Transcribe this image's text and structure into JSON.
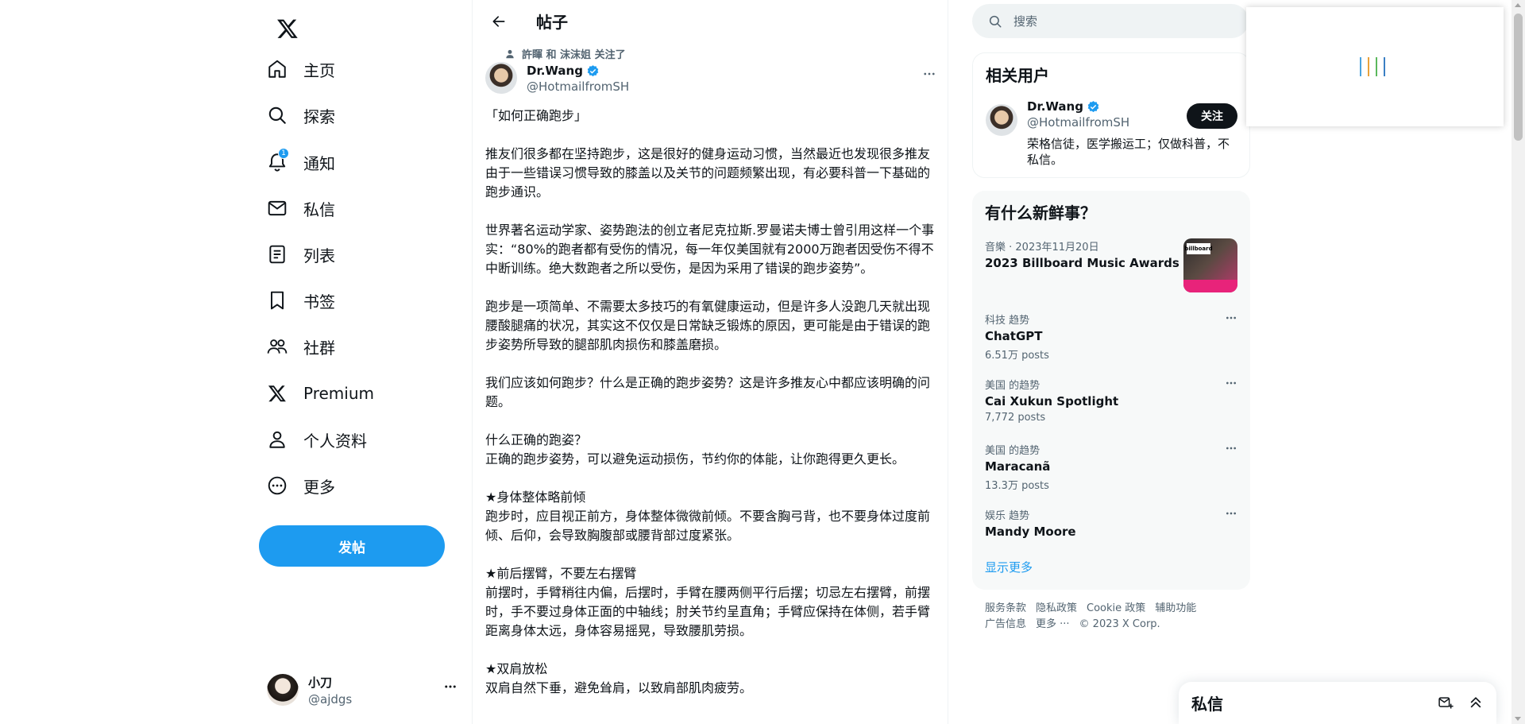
{
  "nav": {
    "items": [
      {
        "label": "主页",
        "icon": "home-icon"
      },
      {
        "label": "探索",
        "icon": "search-icon"
      },
      {
        "label": "通知",
        "icon": "bell-icon",
        "badge": "1"
      },
      {
        "label": "私信",
        "icon": "mail-icon"
      },
      {
        "label": "列表",
        "icon": "list-icon"
      },
      {
        "label": "书签",
        "icon": "bookmark-icon"
      },
      {
        "label": "社群",
        "icon": "people-icon"
      },
      {
        "label": "Premium",
        "icon": "x-logo-icon"
      },
      {
        "label": "个人资料",
        "icon": "person-icon"
      },
      {
        "label": "更多",
        "icon": "more-circle-icon"
      }
    ],
    "post_button": "发帖",
    "account": {
      "name": "小刀",
      "handle": "@ajdgs"
    }
  },
  "main": {
    "header_title": "帖子",
    "social_context": "許睴 和 沫沫姐 关注了",
    "author": {
      "name": "Dr.Wang",
      "handle": "@HotmailfromSH"
    },
    "body": "「如何正确跑步」\n\n推友们很多都在坚持跑步，这是很好的健身运动习惯，当然最近也发现很多推友由于一些错误习惯导致的膝盖以及关节的问题频繁出现，有必要科普一下基础的跑步通识。\n\n世界著名运动学家、姿势跑法的创立者尼克拉斯.罗曼诺夫博士曾引用这样一个事实：“80%的跑者都有受伤的情况，每一年仅美国就有2000万跑者因受伤不得不中断训练。绝大数跑者之所以受伤，是因为采用了错误的跑步姿势”。\n\n跑步是一项简单、不需要太多技巧的有氧健康运动，但是许多人没跑几天就出现腰酸腿痛的状况，其实这不仅仅是日常缺乏锻炼的原因，更可能是由于错误的跑步姿势所导致的腿部肌肉损伤和膝盖磨损。\n\n我们应该如何跑步？什么是正确的跑步姿势？这是许多推友心中都应该明确的问题。\n\n什么正确的跑姿？\n正确的跑步姿势，可以避免运动损伤，节约你的体能，让你跑得更久更长。\n\n★身体整体略前倾\n跑步时，应目视正前方，身体整体微微前倾。不要含胸弓背，也不要身体过度前倾、后仰，会导致胸腹部或腰背部过度紧张。\n\n★前后摆臂，不要左右摆臂\n前摆时，手臂稍往内偏，后摆时，手臂在腰两侧平行后摆；切忌左右摆臂，前摆时，手不要过身体正面的中轴线；肘关节约呈直角；手臂应保持在体侧，若手臂距离身体太远，身体容易摇晃，导致腰肌劳损。\n\n★双肩放松\n双肩自然下垂，避免耸肩，以致肩部肌肉疲劳。"
  },
  "search": {
    "placeholder": "搜索"
  },
  "related": {
    "title": "相关用户",
    "user": {
      "name": "Dr.Wang",
      "handle": "@HotmailfromSH",
      "bio": "荣格信徒，医学搬运工；仅做科普，不私信。"
    },
    "follow_label": "关注"
  },
  "trends": {
    "title": "有什么新鲜事？",
    "featured": {
      "meta": "音樂 · 2023年11月20日",
      "title": "2023 Billboard Music Awards",
      "thumb_text": "billboard"
    },
    "items": [
      {
        "meta": "科技 趋势",
        "title": "ChatGPT",
        "count": "6.51万 posts"
      },
      {
        "meta": "美国 的趋势",
        "title": "Cai Xukun Spotlight",
        "count": "7,772 posts"
      },
      {
        "meta": "美国 的趋势",
        "title": "Maracanã",
        "count": "13.3万 posts"
      },
      {
        "meta": "娱乐 趋势",
        "title": "Mandy Moore",
        "count": ""
      }
    ],
    "show_more": "显示更多"
  },
  "footer": {
    "links": [
      "服务条款",
      "隐私政策",
      "Cookie 政策",
      "辅助功能",
      "广告信息",
      "更多 ···",
      "© 2023 X Corp."
    ]
  },
  "dm": {
    "title": "私信"
  },
  "colors": {
    "accent": "#1d9bf0",
    "text": "#0f1419",
    "muted": "#536471",
    "loader": [
      "#4aa3df",
      "#e8a13a",
      "#5bb85d",
      "#3a7fc4"
    ]
  }
}
